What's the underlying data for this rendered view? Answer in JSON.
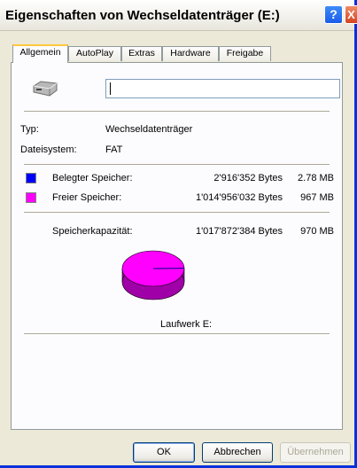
{
  "window": {
    "title": "Eigenschaften von Wechseldatenträger (E:)",
    "help_glyph": "?",
    "close_glyph": "X"
  },
  "tabs": [
    {
      "label": "Allgemein",
      "active": true
    },
    {
      "label": "AutoPlay",
      "active": false
    },
    {
      "label": "Extras",
      "active": false
    },
    {
      "label": "Hardware",
      "active": false
    },
    {
      "label": "Freigabe",
      "active": false
    }
  ],
  "general": {
    "drive_icon": "removable-drive-icon",
    "name_value": "",
    "type_label": "Typ:",
    "type_value": "Wechseldatenträger",
    "fs_label": "Dateisystem:",
    "fs_value": "FAT",
    "used": {
      "label": "Belegter Speicher:",
      "bytes": "2'916'352 Bytes",
      "size": "2.78 MB",
      "color": "#0000ff"
    },
    "free": {
      "label": "Freier Speicher:",
      "bytes": "1'014'956'032 Bytes",
      "size": "967 MB",
      "color": "#ff00ff"
    },
    "capacity": {
      "label": "Speicherkapazität:",
      "bytes": "1'017'872'384 Bytes",
      "size": "970 MB"
    },
    "drive_caption": "Laufwerk E:"
  },
  "usage": {
    "used_fraction": 0.00287
  },
  "buttons": {
    "ok": "OK",
    "cancel": "Abbrechen",
    "apply": "Übernehmen"
  },
  "colors": {
    "title_bar": "#ffffff",
    "accent_border": "#0831d9",
    "tab_highlight": "#ffc83c",
    "pie_free": "#ff00ff",
    "pie_side": "#a000a8"
  }
}
